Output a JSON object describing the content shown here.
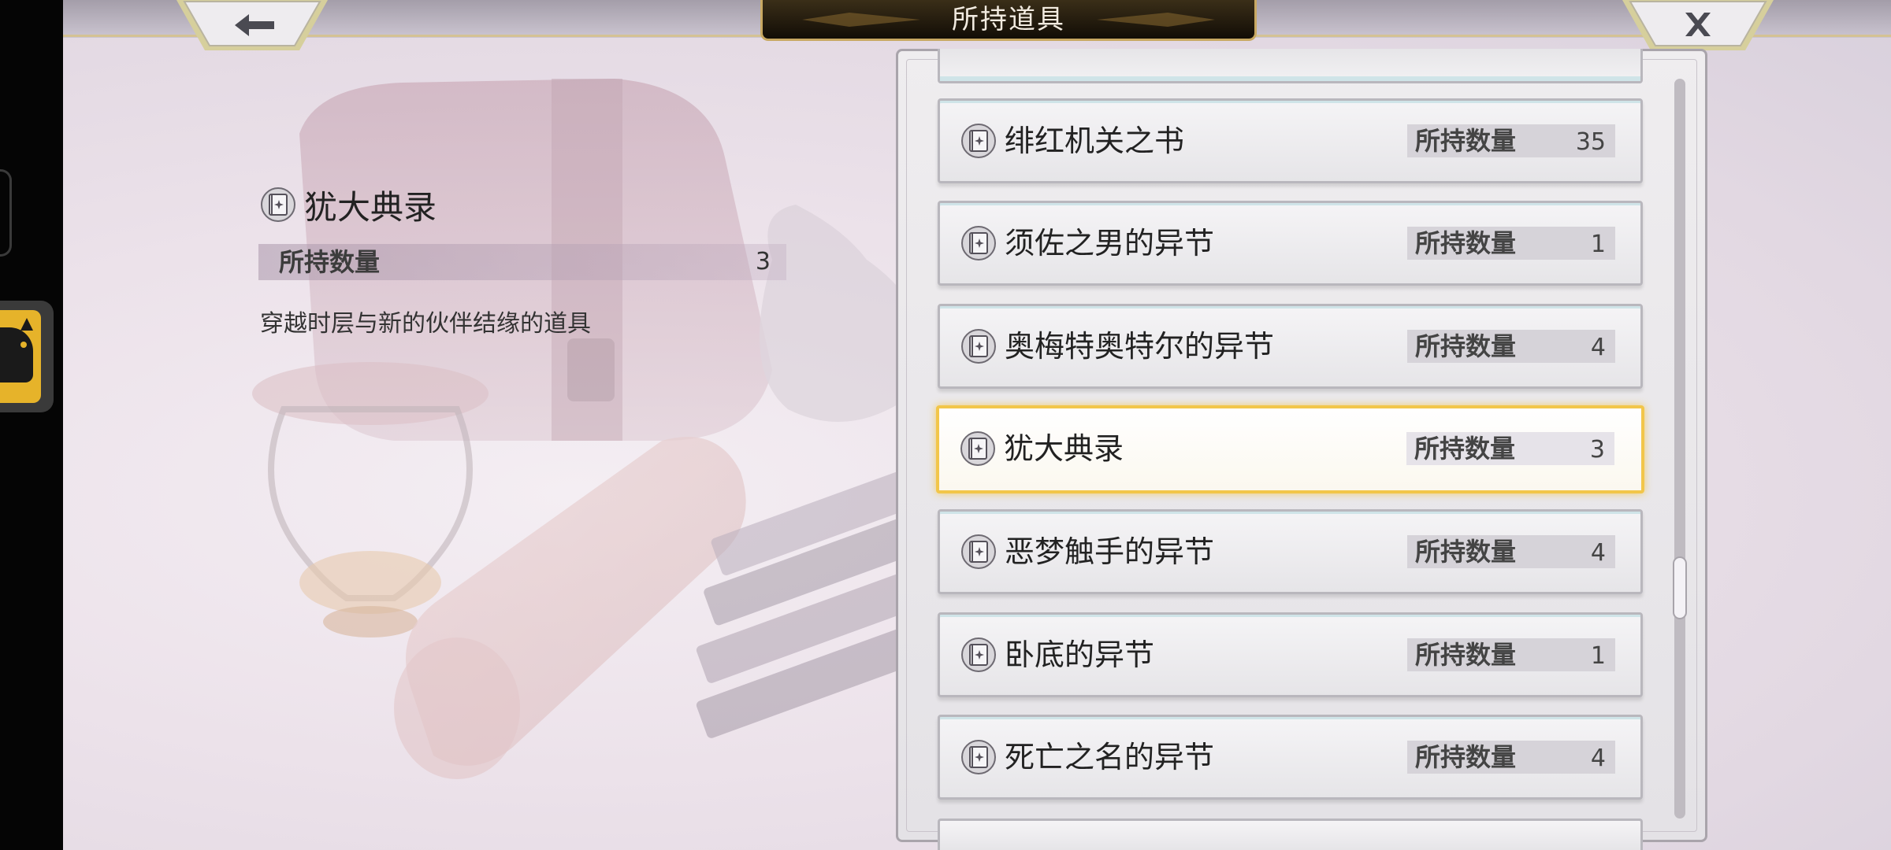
{
  "header": {
    "title": "所持道具",
    "back_icon": "arrow-left-icon",
    "close_icon": "close-x-icon"
  },
  "detail": {
    "name": "犹大典录",
    "qty_label": "所持数量",
    "qty_value": "3",
    "description": "穿越时层与新的伙伴结缘的道具",
    "icon": "book-icon"
  },
  "items": [
    {
      "name": "绯红机关之书",
      "qty_label": "所持数量",
      "qty": "35"
    },
    {
      "name": "须佐之男的异节",
      "qty_label": "所持数量",
      "qty": "1"
    },
    {
      "name": "奥梅特奥特尔的异节",
      "qty_label": "所持数量",
      "qty": "4"
    },
    {
      "name": "犹大典录",
      "qty_label": "所持数量",
      "qty": "3",
      "selected": true
    },
    {
      "name": "恶梦触手的异节",
      "qty_label": "所持数量",
      "qty": "4"
    },
    {
      "name": "卧底的异节",
      "qty_label": "所持数量",
      "qty": "1"
    },
    {
      "name": "死亡之名的异节",
      "qty_label": "所持数量",
      "qty": "4"
    }
  ],
  "colors": {
    "selected_border": "#f2c64a",
    "title_plate": "#1e160a",
    "accent_gold": "#c8a862"
  }
}
